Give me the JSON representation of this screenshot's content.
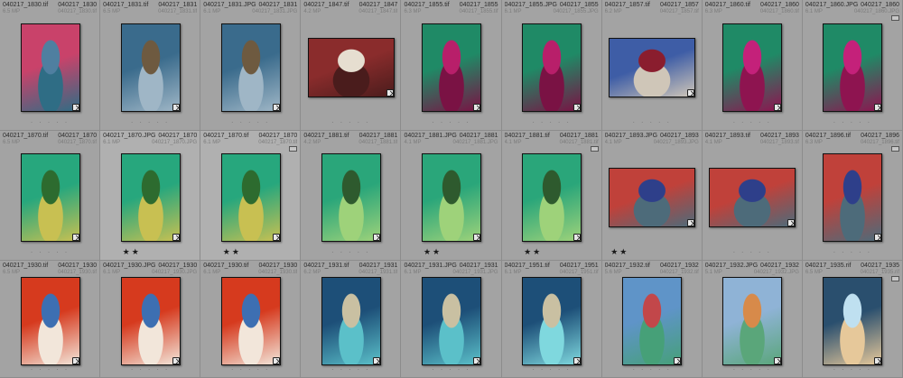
{
  "grid": {
    "rows": [
      [
        {
          "filename": "040217_1830.tif",
          "id": "040217_1830",
          "size": "6.5 MP",
          "dims": "",
          "stars": 0,
          "orient": "portrait",
          "colors": [
            "#c9426a",
            "#4f7fa0",
            "#2f6d85"
          ],
          "rating_label": "· · · · ·"
        },
        {
          "filename": "040217_1831.tif",
          "id": "040217_1831",
          "size": "6.5 MP",
          "dims": "",
          "stars": 0,
          "orient": "portrait",
          "colors": [
            "#3a6b8c",
            "#6e5a40",
            "#9fb6c6"
          ],
          "rating_label": "· · · · ·"
        },
        {
          "filename": "040217_1831.JPG",
          "id": "040217_1831",
          "size": "6.1 MP",
          "dims": "",
          "stars": 0,
          "orient": "portrait",
          "colors": [
            "#3a6b8c",
            "#6e5a40",
            "#9fb6c6"
          ],
          "rating_label": "· · · · ·"
        },
        {
          "filename": "040217_1847.tif",
          "id": "040217_1847",
          "size": "4.2 MP",
          "dims": "",
          "stars": 0,
          "orient": "landscape",
          "colors": [
            "#8a2c2c",
            "#e6ded0",
            "#4a1c1c"
          ],
          "rating_label": "· · · · ·"
        },
        {
          "filename": "040217_1855.tif",
          "id": "040217_1855",
          "size": "6.3 MP",
          "dims": "",
          "stars": 0,
          "orient": "portrait",
          "colors": [
            "#1f8a66",
            "#b81f6a",
            "#7a1244"
          ],
          "rating_label": "· · · · ·"
        },
        {
          "filename": "040217_1855.JPG",
          "id": "040217_1855",
          "size": "6.1 MP",
          "dims": "",
          "stars": 0,
          "orient": "portrait",
          "colors": [
            "#1f8a66",
            "#b81f6a",
            "#7a1244"
          ],
          "rating_label": "· · · · ·"
        },
        {
          "filename": "040217_1857.tif",
          "id": "040217_1857",
          "size": "6.2 MP",
          "dims": "",
          "stars": 0,
          "orient": "landscape",
          "colors": [
            "#3e5da6",
            "#8a1d2e",
            "#cfc6b8"
          ],
          "rating_label": "· · · · ·"
        },
        {
          "filename": "040217_1860.tif",
          "id": "040217_1860",
          "size": "6.3 MP",
          "dims": "",
          "stars": 0,
          "orient": "portrait",
          "colors": [
            "#1f8a66",
            "#c4217a",
            "#8e1450"
          ],
          "rating_label": "· · · · ·"
        },
        {
          "filename": "040217_1860.JPG",
          "id": "040217_1860",
          "size": "6.1 MP",
          "dims": "",
          "stars": 0,
          "orient": "portrait",
          "colors": [
            "#1f8a66",
            "#c4217a",
            "#8e1450"
          ],
          "rating_label": "· · · · ·"
        }
      ],
      [
        {
          "filename": "040217_1870.tif",
          "id": "040217_1870",
          "size": "6.5 MP",
          "dims": "",
          "stars": 0,
          "orient": "portrait",
          "colors": [
            "#27a77d",
            "#2d6b2f",
            "#c8c052"
          ],
          "rating_label": "· · · · ·"
        },
        {
          "filename": "040217_1870.JPG",
          "id": "040217_1870",
          "size": "6.1 MP",
          "dims": "040217_1870.JPG",
          "stars": 2,
          "orient": "portrait",
          "colors": [
            "#27a77d",
            "#2d6b2f",
            "#c8c052"
          ],
          "rating_label": "★★"
        },
        {
          "filename": "040217_1870.tif",
          "id": "040217_1870",
          "size": "6.1 MP",
          "dims": "",
          "stars": 2,
          "orient": "portrait",
          "colors": [
            "#27a77d",
            "#2d6b2f",
            "#c8c052"
          ],
          "rating_label": "★★"
        },
        {
          "filename": "040217_1881.tif",
          "id": "040217_1881",
          "size": "4.2 MP",
          "dims": "",
          "stars": 0,
          "orient": "portrait",
          "colors": [
            "#2aa67a",
            "#2e5a2e",
            "#9ed27a"
          ],
          "rating_label": "· · · · ·"
        },
        {
          "filename": "040217_1881.JPG",
          "id": "040217_1881",
          "size": "4.1 MP",
          "dims": "",
          "stars": 2,
          "orient": "portrait",
          "colors": [
            "#2aa67a",
            "#2e5a2e",
            "#9ed27a"
          ],
          "rating_label": "★★"
        },
        {
          "filename": "040217_1881.tif",
          "id": "040217_1881",
          "size": "4.1 MP",
          "dims": "",
          "stars": 2,
          "orient": "portrait",
          "colors": [
            "#2aa67a",
            "#2e5a2e",
            "#9ed27a"
          ],
          "rating_label": "★★"
        },
        {
          "filename": "040217_1893.JPG",
          "id": "040217_1893",
          "size": "4.1 MP",
          "dims": "",
          "stars": 2,
          "orient": "landscape",
          "colors": [
            "#c0413a",
            "#2e3f8a",
            "#4d6b7a"
          ],
          "rating_label": "★★"
        },
        {
          "filename": "040217_1893.tif",
          "id": "040217_1893",
          "size": "4.1 MP",
          "dims": "",
          "stars": 0,
          "orient": "landscape",
          "colors": [
            "#c0413a",
            "#2e3f8a",
            "#4d6b7a"
          ],
          "rating_label": "· · · · ·"
        },
        {
          "filename": "040217_1896.tif",
          "id": "040217_1896",
          "size": "6.3 MP",
          "dims": "",
          "stars": 0,
          "orient": "portrait",
          "colors": [
            "#c0413a",
            "#2e3f8a",
            "#4d6b7a"
          ],
          "rating_label": "· · · · ·"
        }
      ],
      [
        {
          "filename": "040217_1930.tif",
          "id": "040217_1930",
          "size": "6.5 MP",
          "dims": "",
          "stars": 0,
          "orient": "portrait",
          "colors": [
            "#d63a1e",
            "#3d6fb2",
            "#f2e6da"
          ],
          "rating_label": "· · · · ·"
        },
        {
          "filename": "040217_1930.JPG",
          "id": "040217_1930",
          "size": "6.1 MP",
          "dims": "",
          "stars": 0,
          "orient": "portrait",
          "colors": [
            "#d63a1e",
            "#3d6fb2",
            "#f2e6da"
          ],
          "rating_label": "· · · · ·"
        },
        {
          "filename": "040217_1930.tif",
          "id": "040217_1930",
          "size": "6.1 MP",
          "dims": "",
          "stars": 0,
          "orient": "portrait",
          "colors": [
            "#d63a1e",
            "#3d6fb2",
            "#f2e6da"
          ],
          "rating_label": "· · · · ·"
        },
        {
          "filename": "040217_1931.tif",
          "id": "040217_1931",
          "size": "6.2 MP",
          "dims": "",
          "stars": 0,
          "orient": "portrait",
          "colors": [
            "#1d4f78",
            "#c9c0a2",
            "#5bc0c9"
          ],
          "rating_label": "· · · · ·"
        },
        {
          "filename": "040217_1931.JPG",
          "id": "040217_1931",
          "size": "6.1 MP",
          "dims": "",
          "stars": 0,
          "orient": "portrait",
          "colors": [
            "#1d4f78",
            "#c9c0a2",
            "#5bc0c9"
          ],
          "rating_label": "· · · · ·"
        },
        {
          "filename": "040217_1951.tif",
          "id": "040217_1951",
          "size": "6.1 MP",
          "dims": "",
          "stars": 0,
          "orient": "portrait",
          "colors": [
            "#1d4f78",
            "#c9c0a2",
            "#7fd8de"
          ],
          "rating_label": "· · · · ·"
        },
        {
          "filename": "040217_1932.tif",
          "id": "040217_1932",
          "size": "5.6 MP",
          "dims": "",
          "stars": 0,
          "orient": "portrait",
          "colors": [
            "#5f94c8",
            "#c2474a",
            "#46a078"
          ],
          "rating_label": "· · · · ·"
        },
        {
          "filename": "040217_1932.JPG",
          "id": "040217_1932",
          "size": "5.1 MP",
          "dims": "",
          "stars": 0,
          "orient": "portrait",
          "colors": [
            "#8fb3d6",
            "#d78a4a",
            "#5aa67a"
          ],
          "rating_label": "· · · · ·"
        },
        {
          "filename": "040217_1935.rif",
          "id": "040217_1935",
          "size": "6.5 MP",
          "dims": "",
          "stars": 0,
          "orient": "portrait",
          "colors": [
            "#2a4f6e",
            "#bfe0f0",
            "#e6c89a"
          ],
          "rating_label": "· · · · ·"
        }
      ]
    ]
  }
}
